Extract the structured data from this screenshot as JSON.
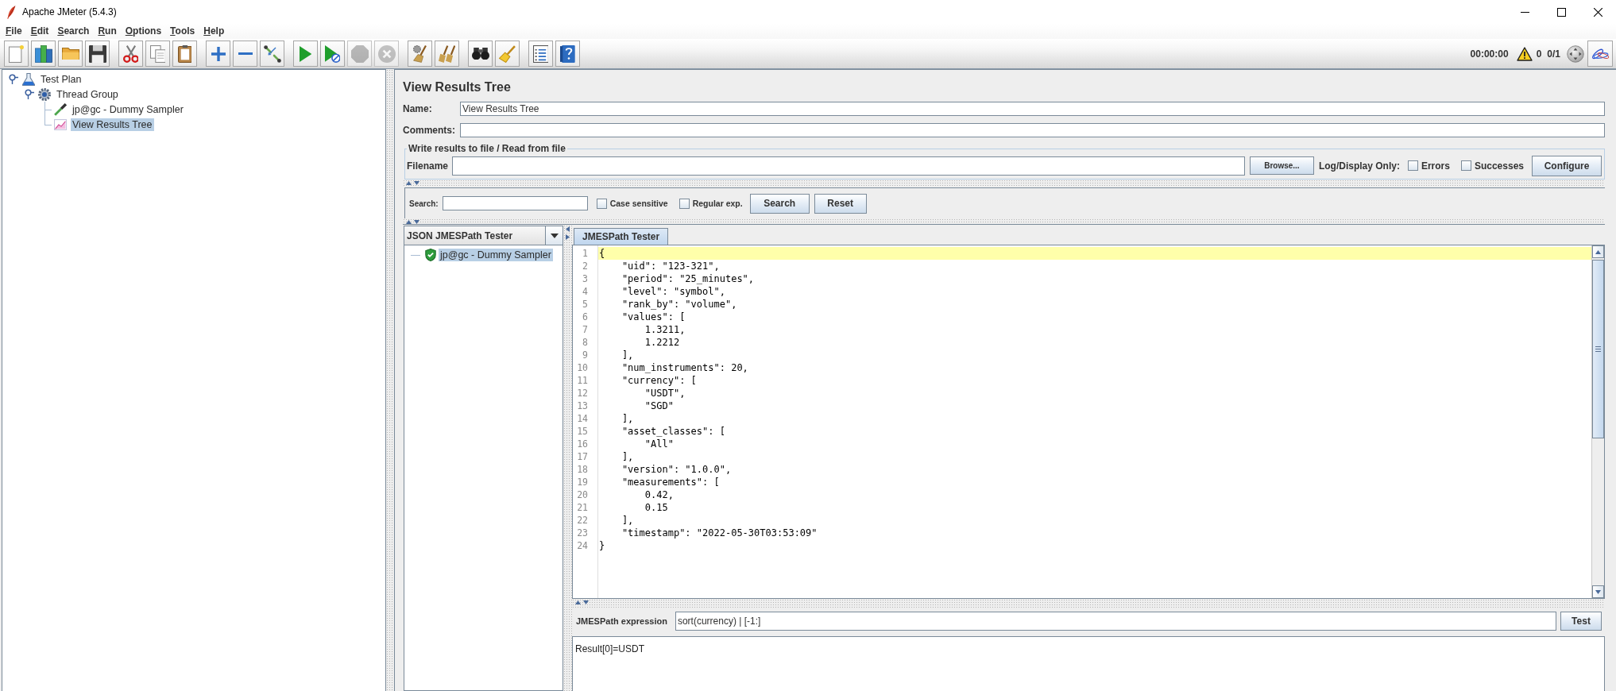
{
  "window": {
    "title": "Apache JMeter (5.4.3)"
  },
  "menu": [
    "File",
    "Edit",
    "Search",
    "Run",
    "Options",
    "Tools",
    "Help"
  ],
  "toolbar": {
    "groups": [
      {
        "buttons": [
          {
            "kind": "new",
            "disabled": false
          },
          {
            "kind": "templates",
            "disabled": false
          },
          {
            "kind": "open",
            "disabled": false
          },
          {
            "kind": "save",
            "disabled": false
          }
        ]
      },
      {
        "buttons": [
          {
            "kind": "cut",
            "disabled": false
          },
          {
            "kind": "copy",
            "disabled": false
          },
          {
            "kind": "paste",
            "disabled": false
          }
        ]
      },
      {
        "buttons": [
          {
            "kind": "expand",
            "disabled": false
          },
          {
            "kind": "collapse",
            "disabled": false
          },
          {
            "kind": "toggle",
            "disabled": false
          }
        ]
      },
      {
        "buttons": [
          {
            "kind": "start",
            "disabled": false
          },
          {
            "kind": "start_no_pauses",
            "disabled": false
          },
          {
            "kind": "stop",
            "disabled": true
          },
          {
            "kind": "shutdown",
            "disabled": true
          }
        ]
      },
      {
        "buttons": [
          {
            "kind": "clear",
            "disabled": false
          },
          {
            "kind": "clear_all",
            "disabled": false
          }
        ]
      },
      {
        "buttons": [
          {
            "kind": "search",
            "disabled": false
          },
          {
            "kind": "reset_search",
            "disabled": false
          }
        ]
      },
      {
        "buttons": [
          {
            "kind": "function_helper",
            "disabled": false
          },
          {
            "kind": "help",
            "disabled": false
          }
        ]
      }
    ],
    "status": {
      "elapsed": "00:00:00",
      "warnings": "0",
      "threads": "0/1"
    }
  },
  "tree": {
    "items": [
      {
        "label": "Test Plan",
        "kind": "test_plan",
        "expanded": true,
        "selected": false,
        "children": [
          {
            "label": "Thread Group",
            "kind": "thread_group",
            "expanded": true,
            "selected": false,
            "children": [
              {
                "label": "jp@gc - Dummy Sampler",
                "kind": "sampler",
                "selected": false
              },
              {
                "label": "View Results Tree",
                "kind": "listener",
                "selected": true
              }
            ]
          }
        ]
      }
    ]
  },
  "panel": {
    "title": "View Results Tree",
    "fields": [
      {
        "label": "Name:",
        "value": "View Results Tree"
      },
      {
        "label": "Comments:"
      }
    ],
    "file_group": {
      "title": "Write results to file / Read from file",
      "filename_label": "Filename",
      "browse": "Browse...",
      "log_label": "Log/Display Only:",
      "options": [
        {
          "label": "Errors",
          "checked": false
        },
        {
          "label": "Successes",
          "checked": false
        }
      ],
      "configure": "Configure"
    }
  },
  "search": {
    "label": "Search:",
    "options": [
      {
        "label": "Case sensitive",
        "checked": false
      },
      {
        "label": "Regular exp.",
        "checked": false
      }
    ],
    "buttons": [
      "Search",
      "Reset"
    ]
  },
  "results": {
    "renderer": "JSON JMESPath Tester",
    "samples": [
      {
        "label": "jp@gc - Dummy Sampler",
        "kind": "success",
        "selected": true
      }
    ],
    "tabs": [
      {
        "label": "JMESPath Tester",
        "selected": true
      }
    ],
    "editor": {
      "lines": [
        {
          "number": "1",
          "text": "{",
          "current": true
        },
        {
          "number": "2",
          "text": "    \"uid\": \"123-321\",",
          "current": false
        },
        {
          "number": "3",
          "text": "    \"period\": \"25_minutes\",",
          "current": false
        },
        {
          "number": "4",
          "text": "    \"level\": \"symbol\",",
          "current": false
        },
        {
          "number": "5",
          "text": "    \"rank_by\": \"volume\",",
          "current": false
        },
        {
          "number": "6",
          "text": "    \"values\": [",
          "current": false
        },
        {
          "number": "7",
          "text": "        1.3211,",
          "current": false
        },
        {
          "number": "8",
          "text": "        1.2212",
          "current": false
        },
        {
          "number": "9",
          "text": "    ],",
          "current": false
        },
        {
          "number": "10",
          "text": "    \"num_instruments\": 20,",
          "current": false
        },
        {
          "number": "11",
          "text": "    \"currency\": [",
          "current": false
        },
        {
          "number": "12",
          "text": "        \"USDT\",",
          "current": false
        },
        {
          "number": "13",
          "text": "        \"SGD\"",
          "current": false
        },
        {
          "number": "14",
          "text": "    ],",
          "current": false
        },
        {
          "number": "15",
          "text": "    \"asset_classes\": [",
          "current": false
        },
        {
          "number": "16",
          "text": "        \"All\"",
          "current": false
        },
        {
          "number": "17",
          "text": "    ],",
          "current": false
        },
        {
          "number": "18",
          "text": "    \"version\": \"1.0.0\",",
          "current": false
        },
        {
          "number": "19",
          "text": "    \"measurements\": [",
          "current": false
        },
        {
          "number": "20",
          "text": "        0.42,",
          "current": false
        },
        {
          "number": "21",
          "text": "        0.15",
          "current": false
        },
        {
          "number": "22",
          "text": "    ],",
          "current": false
        },
        {
          "number": "23",
          "text": "    \"timestamp\": \"2022-05-30T03:53:09\"",
          "current": false
        },
        {
          "number": "24",
          "text": "}",
          "current": false
        }
      ]
    },
    "expression": {
      "label": "JMESPath expression",
      "value": "sort(currency) | [-1:]",
      "button": "Test"
    },
    "output": "Result[0]=USDT"
  }
}
